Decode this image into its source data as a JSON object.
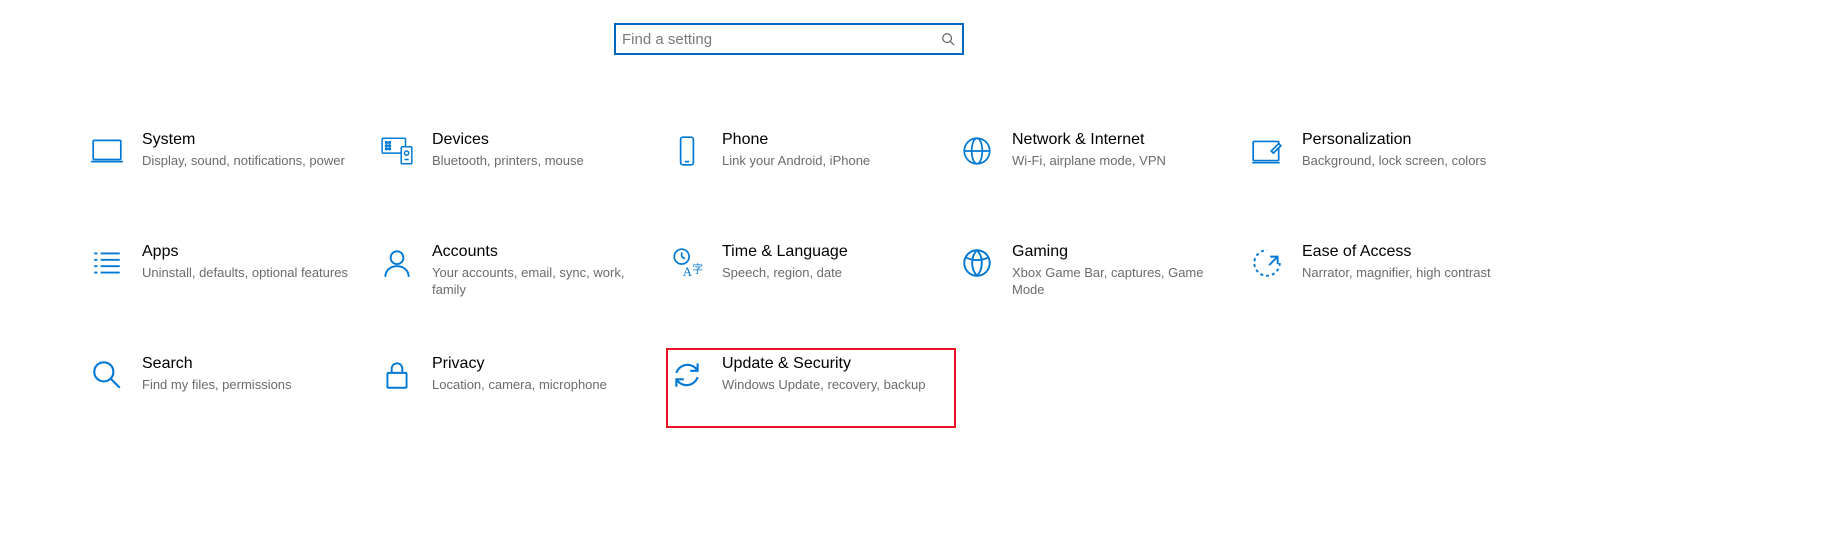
{
  "search": {
    "placeholder": "Find a setting"
  },
  "tiles": {
    "system": {
      "title": "System",
      "sub": "Display, sound, notifications, power"
    },
    "devices": {
      "title": "Devices",
      "sub": "Bluetooth, printers, mouse"
    },
    "phone": {
      "title": "Phone",
      "sub": "Link your Android, iPhone"
    },
    "network": {
      "title": "Network & Internet",
      "sub": "Wi-Fi, airplane mode, VPN"
    },
    "personalization": {
      "title": "Personalization",
      "sub": "Background, lock screen, colors"
    },
    "apps": {
      "title": "Apps",
      "sub": "Uninstall, defaults, optional features"
    },
    "accounts": {
      "title": "Accounts",
      "sub": "Your accounts, email, sync, work, family"
    },
    "time": {
      "title": "Time & Language",
      "sub": "Speech, region, date"
    },
    "gaming": {
      "title": "Gaming",
      "sub": "Xbox Game Bar, captures, Game Mode"
    },
    "ease": {
      "title": "Ease of Access",
      "sub": "Narrator, magnifier, high contrast"
    },
    "search_cat": {
      "title": "Search",
      "sub": "Find my files, permissions"
    },
    "privacy": {
      "title": "Privacy",
      "sub": "Location, camera, microphone"
    },
    "update": {
      "title": "Update & Security",
      "sub": "Windows Update, recovery, backup"
    }
  }
}
